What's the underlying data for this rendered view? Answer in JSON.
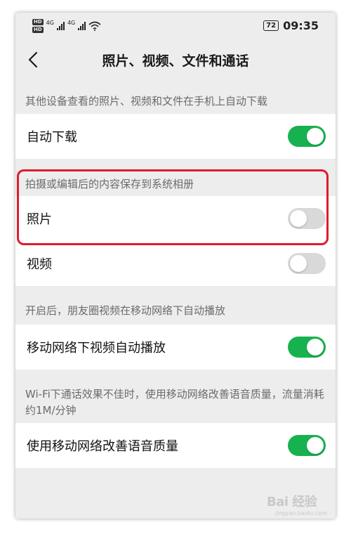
{
  "status_bar": {
    "badges": [
      "HD",
      "HD"
    ],
    "network_types": [
      "4G",
      "4G"
    ],
    "battery": "72",
    "time": "09:35"
  },
  "header": {
    "title": "照片、视频、文件和通话"
  },
  "sections": [
    {
      "caption": "其他设备查看的照片、视频和文件在手机上自动下载",
      "items": [
        {
          "label": "自动下载",
          "on": true
        }
      ]
    },
    {
      "caption": "拍摄或编辑后的内容保存到系统相册",
      "items": [
        {
          "label": "照片",
          "on": false
        },
        {
          "label": "视频",
          "on": false
        }
      ]
    },
    {
      "caption": "开启后，朋友圈视频在移动网络下自动播放",
      "items": [
        {
          "label": "移动网络下视频自动播放",
          "on": true
        }
      ]
    },
    {
      "caption": "Wi-Fi下通话效果不佳时，使用移动网络改善语音质量，流量消耗约1M/分钟",
      "items": [
        {
          "label": "使用移动网络改善语音质量",
          "on": true
        }
      ]
    }
  ],
  "colors": {
    "toggle_on": "#17b24f",
    "toggle_off": "#d9d9d9",
    "highlight": "#e01b2f"
  },
  "watermark": {
    "main": "Bai 经验",
    "sub": "jingyan.baidu.com"
  }
}
